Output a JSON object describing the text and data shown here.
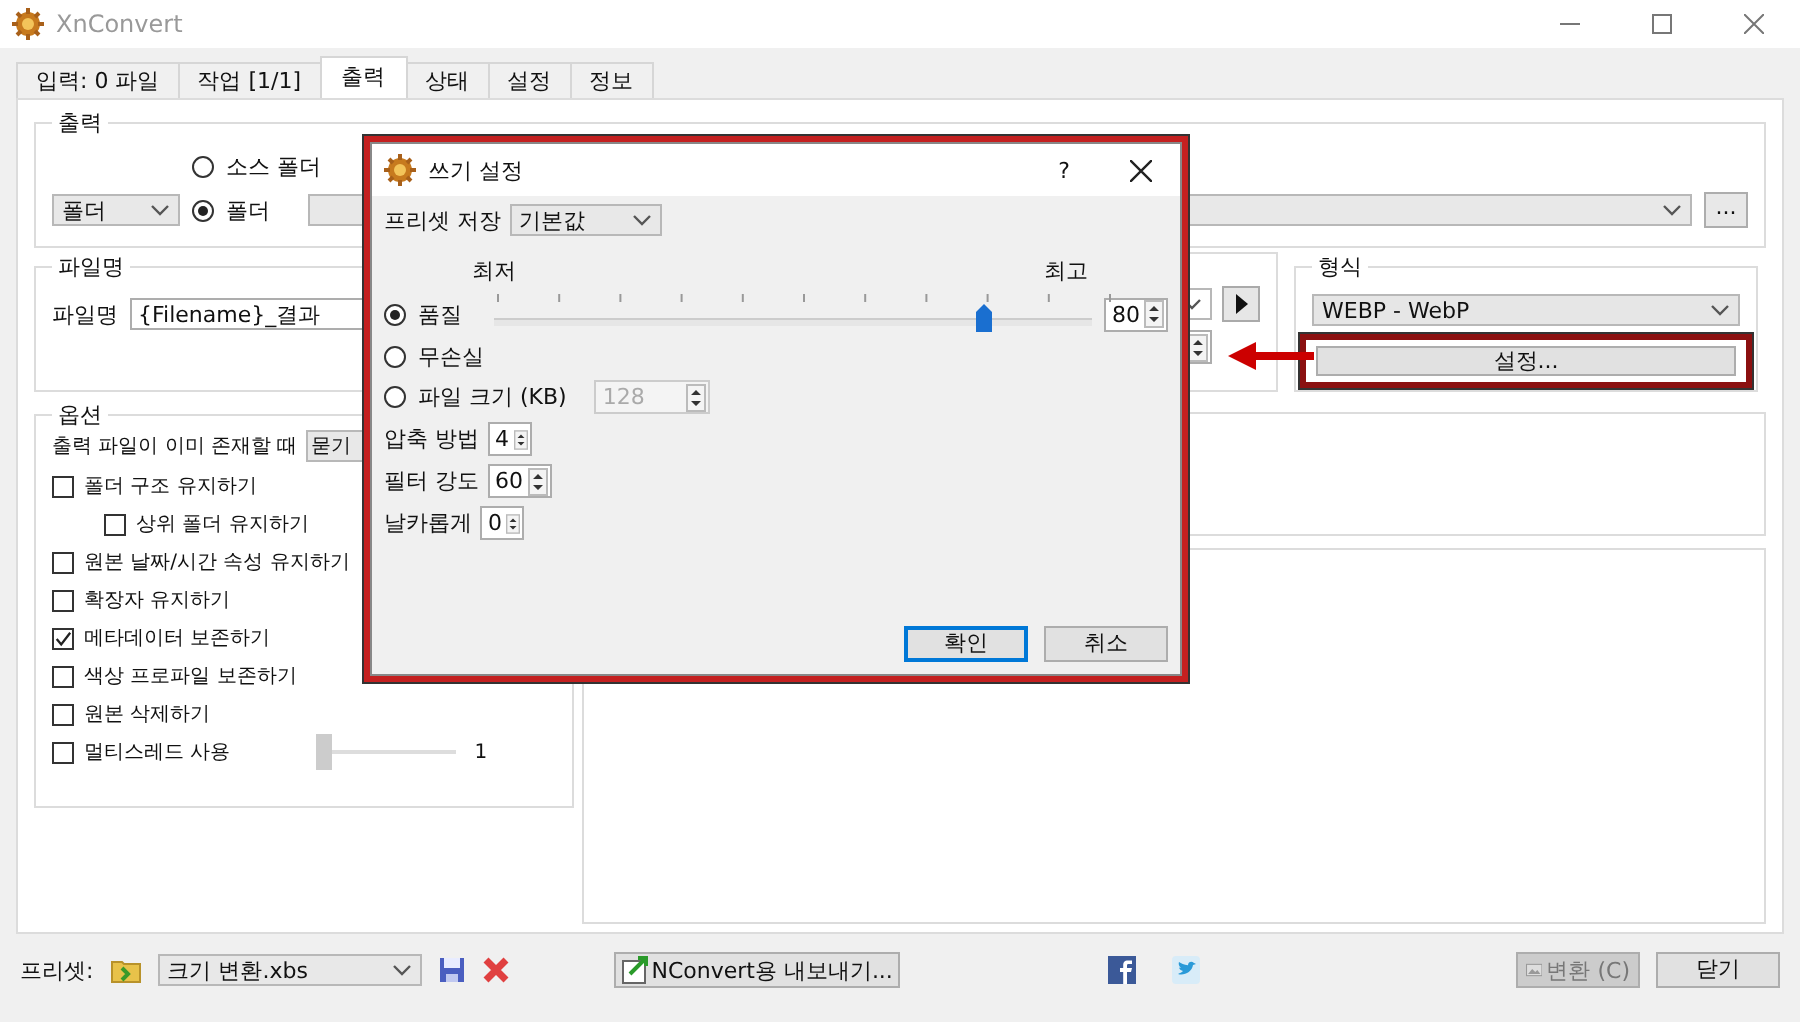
{
  "window": {
    "title": "XnConvert"
  },
  "tabs": [
    {
      "label": "입력: 0 파일",
      "selected": false
    },
    {
      "label": "작업 [1/1]",
      "selected": false
    },
    {
      "label": "출력",
      "selected": true
    },
    {
      "label": "상태",
      "selected": false
    },
    {
      "label": "설정",
      "selected": false
    },
    {
      "label": "정보",
      "selected": false
    }
  ],
  "output_group": {
    "title": "출력",
    "mode": "폴더",
    "browse_button": "...",
    "destinations": [
      {
        "label": "소스 폴더",
        "selected": false
      },
      {
        "label": "폴더",
        "selected": true
      }
    ]
  },
  "filename_group": {
    "title": "파일명",
    "label": "파일명",
    "value": "{Filename}_결과"
  },
  "format_group": {
    "title": "형식",
    "format": "WEBP - WebP",
    "settings_button": "설정...",
    "highlighted": true
  },
  "options_group": {
    "title": "옵션",
    "overwrite_label": "출력 파일이 이미 존재할 때",
    "overwrite_value": "묻기",
    "checkboxes": [
      {
        "label": "폴더 구조 유지하기",
        "checked": false,
        "children": [
          {
            "label": "상위 폴더 유지하기",
            "checked": false
          }
        ]
      },
      {
        "label": "원본 날짜/시간 속성 유지하기",
        "checked": false
      },
      {
        "label": "확장자 유지하기",
        "checked": false
      },
      {
        "label": "메타데이터 보존하기",
        "checked": true
      },
      {
        "label": "색상 프로파일 보존하기",
        "checked": false
      },
      {
        "label": "원본 삭제하기",
        "checked": false
      }
    ],
    "multithread": {
      "label": "멀티스레드 사용",
      "checked": false,
      "level": 0,
      "reading": "1"
    }
  },
  "footer": {
    "preset_label": "프리셋:",
    "preset_value": "크기 변환.xbs",
    "export_button": "NConvert용 내보내기...",
    "convert_button": {
      "label": "변환 (C)",
      "disabled": true
    },
    "close_button": "닫기"
  },
  "dialog": {
    "title": "쓰기 설정",
    "help": "?",
    "highlighted": true,
    "preset_label": "프리셋 저장",
    "preset_value": "기본값",
    "min_label": "최저",
    "max_label": "최고",
    "modes": [
      {
        "label": "품질",
        "selected": true
      },
      {
        "label": "무손실",
        "selected": false
      },
      {
        "label": "파일 크기 (KB)",
        "selected": false
      }
    ],
    "quality": {
      "level": 0.8,
      "value": "80"
    },
    "file_size": {
      "value": "128",
      "disabled": true
    },
    "params": [
      {
        "label": "압축 방법",
        "value": "4"
      },
      {
        "label": "필터 강도",
        "value": "60"
      },
      {
        "label": "날카롭게",
        "value": "0"
      }
    ],
    "buttons": [
      {
        "label": "확인",
        "default": true
      },
      {
        "label": "취소",
        "default": false
      }
    ]
  }
}
